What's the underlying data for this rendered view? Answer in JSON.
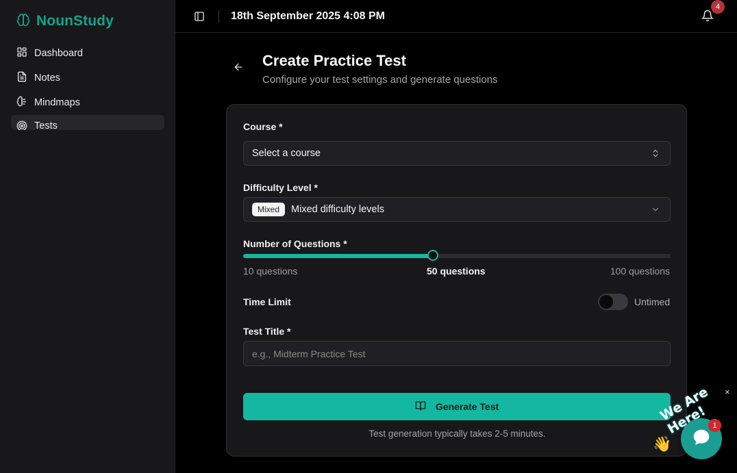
{
  "brand": {
    "name": "NounStudy",
    "icon": "brain-icon",
    "color": "#14a38b"
  },
  "sidebar": {
    "items": [
      {
        "label": "Dashboard",
        "icon": "dashboard-icon",
        "active": false
      },
      {
        "label": "Notes",
        "icon": "notes-icon",
        "active": false
      },
      {
        "label": "Mindmaps",
        "icon": "mindmap-icon",
        "active": false
      },
      {
        "label": "Tests",
        "icon": "target-icon",
        "active": true
      }
    ]
  },
  "topbar": {
    "datetime": "18th September 2025 4:08 PM",
    "notification_count": "4"
  },
  "header": {
    "title": "Create Practice Test",
    "subtitle": "Configure your test settings and generate questions"
  },
  "form": {
    "course": {
      "label": "Course *",
      "value": "Select a course"
    },
    "difficulty": {
      "label": "Difficulty Level *",
      "badge": "Mixed",
      "value": "Mixed difficulty levels"
    },
    "questions": {
      "label": "Number of Questions *",
      "min_label": "10 questions",
      "current_label": "50 questions",
      "max_label": "100 questions",
      "min": 10,
      "max": 100,
      "value": 50
    },
    "time_limit": {
      "label": "Time Limit",
      "state_label": "Untimed",
      "enabled": false
    },
    "title": {
      "label": "Test Title *",
      "placeholder": "e.g., Midterm Practice Test",
      "value": ""
    },
    "generate_label": "Generate Test",
    "generate_note": "Test generation typically takes 2-5 minutes."
  },
  "chat_widget": {
    "close_label": "×",
    "banner": "We Are Here!",
    "unread": "1"
  },
  "colors": {
    "accent": "#14b8a0",
    "badge": "#b5343c",
    "chat": "#1a9d93"
  }
}
